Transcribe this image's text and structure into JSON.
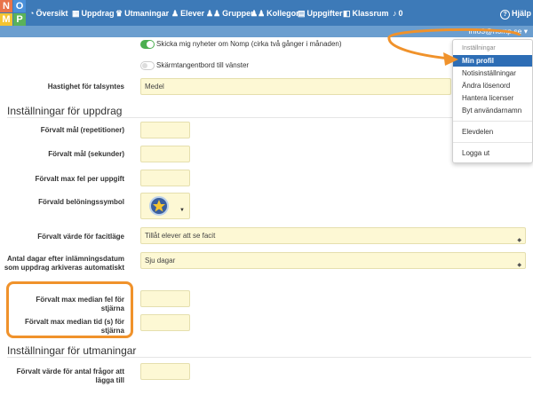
{
  "nav": {
    "logo_letters": [
      "N",
      "O",
      "M",
      "P"
    ],
    "logo_colors": [
      "#e8734a",
      "#4a90d9",
      "#f5c431",
      "#5ab25a"
    ],
    "items": [
      {
        "icon": "dashboard-icon",
        "glyph": "◔",
        "label": "Översikt"
      },
      {
        "icon": "calendar-icon",
        "glyph": "▦",
        "label": "Uppdrag"
      },
      {
        "icon": "trophy-icon",
        "glyph": "♛",
        "label": "Utmaningar"
      },
      {
        "icon": "user-icon",
        "glyph": "♟",
        "label": "Elever"
      },
      {
        "icon": "users-icon",
        "glyph": "♟♟",
        "label": "Grupper"
      },
      {
        "icon": "colleagues-icon",
        "glyph": "♟♟",
        "label": "Kollegor"
      },
      {
        "icon": "tasks-icon",
        "glyph": "▤",
        "label": "Uppgifter"
      },
      {
        "icon": "classroom-icon",
        "glyph": "◧",
        "label": "Klassrum"
      },
      {
        "icon": "bell-icon",
        "glyph": "♪",
        "label": "0"
      }
    ],
    "help": {
      "glyph": "?",
      "label": "Hjälp"
    }
  },
  "user_menu": {
    "label": "info3@nomp.se",
    "caret": "▾"
  },
  "dropdown": {
    "header": "Inställningar",
    "items": [
      "Min profil",
      "Notisinställningar",
      "Ändra lösenord",
      "Hantera licenser",
      "Byt användarnamn"
    ],
    "items2": [
      "Elevdelen"
    ],
    "items3": [
      "Logga ut"
    ]
  },
  "settings": {
    "newsletter": "Skicka mig nyheter om Nomp (cirka två gånger i månaden)",
    "keyboard": "Skärmtangentbord till vänster",
    "speech_label": "Hastighet för talsyntes",
    "speech_value": "Medel"
  },
  "assignments": {
    "title": "Inställningar för uppdrag",
    "goal_reps": "Förvalt mål (repetitioner)",
    "goal_secs": "Förvalt mål (sekunder)",
    "max_errors": "Förvalt max fel per uppgift",
    "reward_symbol": "Förvald belöningssymbol",
    "answer_label": "Förvalt värde för facitläge",
    "answer_value": "Tillåt elever att se facit",
    "archive_label": "Antal dagar efter inlämningsdatum som uppdrag arkiveras automatiskt",
    "archive_value": "Sju dagar",
    "median_errors": "Förvalt max median fel för stjärna",
    "median_time": "Förvalt max median tid (s) för stjärna"
  },
  "challenges": {
    "title": "Inställningar för utmaningar",
    "questions_label": "Förvalt värde för antal frågor att lägga till"
  },
  "colors": {
    "navbar": "#3d7ab8",
    "accent": "#f0922b",
    "highlight": "#2d6db5"
  }
}
